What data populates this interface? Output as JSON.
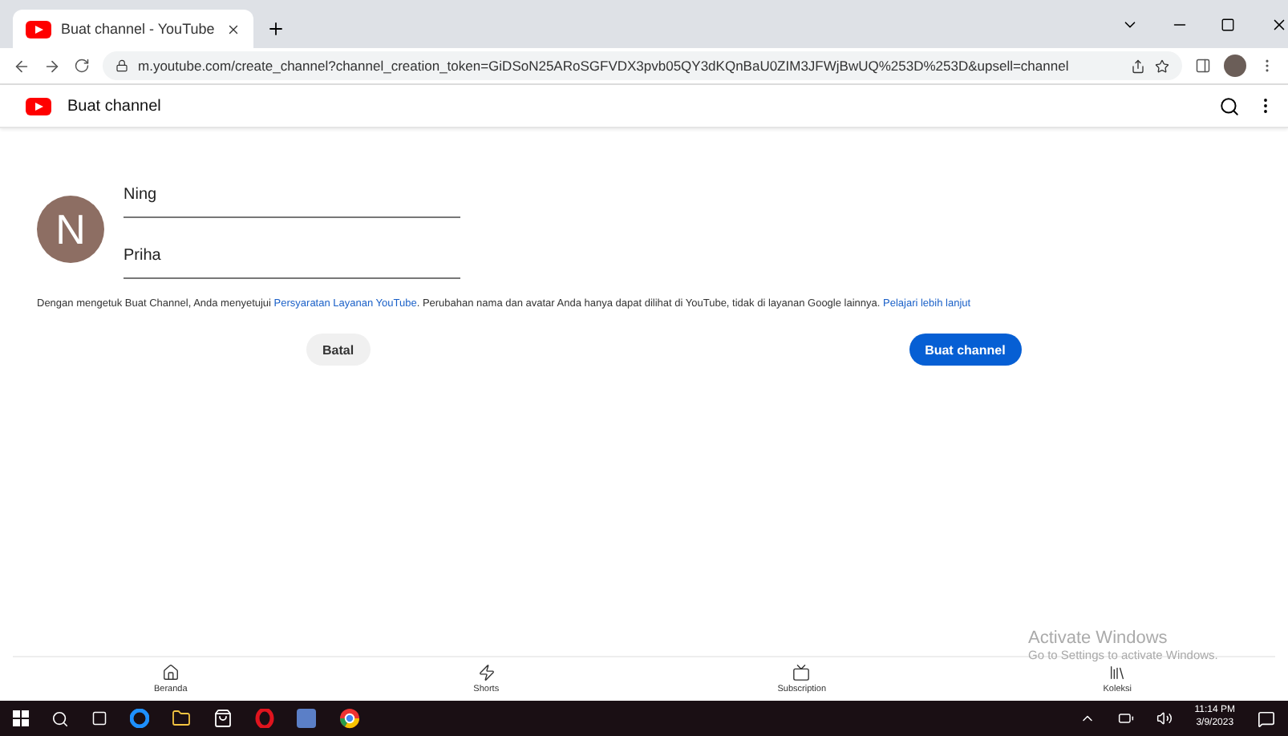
{
  "browser": {
    "tab_title": "Buat channel - YouTube",
    "url": "m.youtube.com/create_channel?channel_creation_token=GiDSoN25ARoSGFVDX3pvb05QY3dKQnBaU0ZIM3JFWjBwUQ%253D%253D&upsell=channel"
  },
  "header": {
    "title": "Buat channel"
  },
  "form": {
    "avatar_letter": "N",
    "first_name": "Ning",
    "last_name": "Priha",
    "notice": "Dengan mengetuk Buat Channel, Anda menyetujui ",
    "terms_link": "Persyaratan Layanan YouTube",
    "notice_2": ". Perubahan nama dan avatar Anda hanya dapat dilihat di YouTube, tidak di layanan Google lainnya. ",
    "learn_link": "Pelajari lebih lanjut",
    "cancel": "Batal",
    "create": "Buat channel"
  },
  "bottom_nav": [
    {
      "kind": "home",
      "label": "Beranda"
    },
    {
      "kind": "shorts",
      "label": "Shorts"
    },
    {
      "kind": "subscriptions",
      "label": "Subscription"
    },
    {
      "kind": "library",
      "label": "Koleksi"
    }
  ],
  "activation": {
    "title": "Activate Windows",
    "subtitle": "Go to Settings to activate Windows."
  },
  "taskbar": {
    "time": "11:14 PM",
    "date": "3/9/2023"
  }
}
